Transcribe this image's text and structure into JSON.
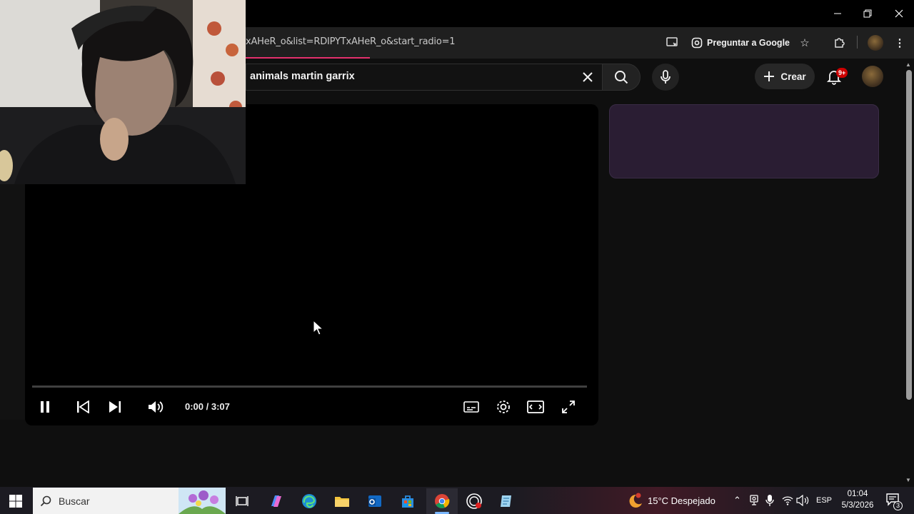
{
  "browser": {
    "url": "xAHeR_o&list=RDIPYTxAHeR_o&start_radio=1",
    "ask_google_label": "Preguntar a Google"
  },
  "youtube": {
    "search_query": "animals martin garrix",
    "create_label": "Crear",
    "notification_count": "9+"
  },
  "player": {
    "time_display": "0:00 / 3:07",
    "progress": 0
  },
  "taskbar": {
    "search_placeholder": "Buscar",
    "weather": "15°C  Despejado",
    "language": "ESP",
    "time": "01:04",
    "date": "5/3/2026",
    "notification_count": "3"
  },
  "colors": {
    "youtube_bg": "#0f0f0f",
    "loading_bar": "#e3306c",
    "notification_badge": "#cc0000",
    "sidebar_card": "#2a1d33"
  }
}
